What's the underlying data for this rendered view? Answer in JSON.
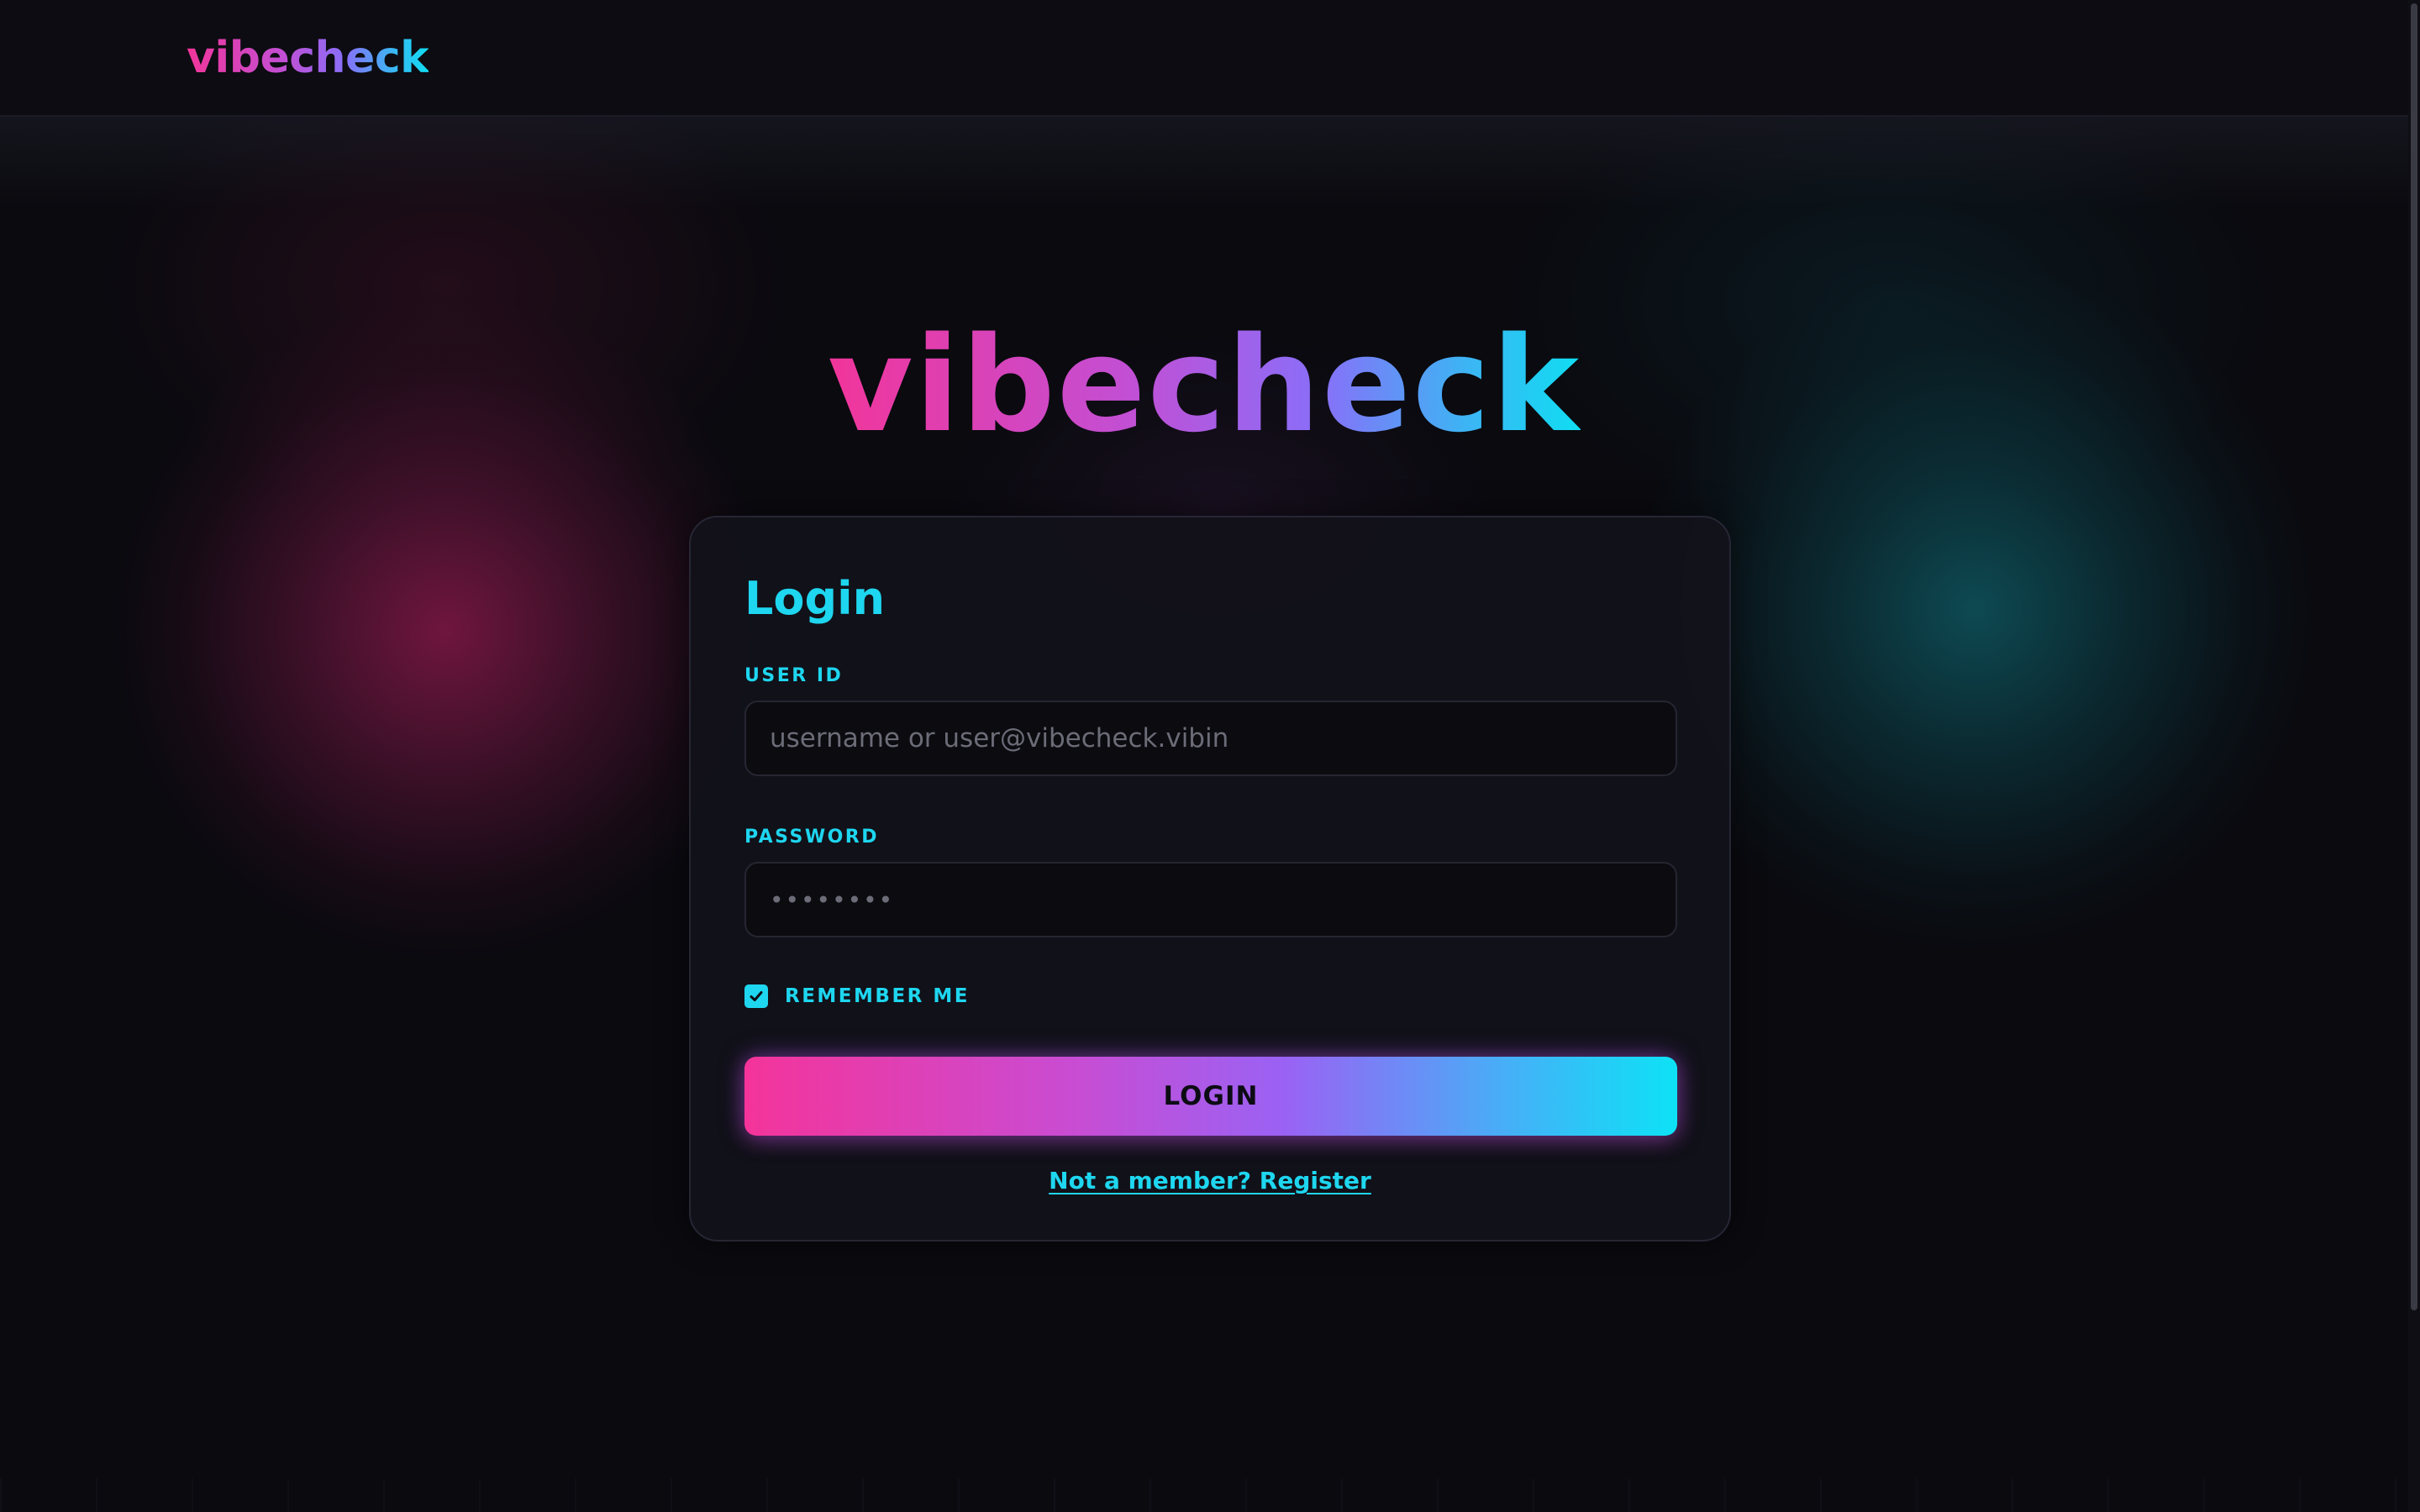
{
  "header": {
    "brand": "vibecheck"
  },
  "hero": {
    "title": "vibecheck"
  },
  "login_card": {
    "title": "Login",
    "user_id_label": "USER ID",
    "user_id_placeholder": "username or user@vibecheck.vibin",
    "user_id_value": "",
    "password_label": "PASSWORD",
    "password_placeholder": "••••••••",
    "password_value": "",
    "remember_me_label": "REMEMBER ME",
    "remember_me_checked": true,
    "login_button_label": "LOGIN",
    "register_link": "Not a member? Register"
  },
  "icons": {
    "remember_checkbox": "check-icon"
  },
  "colors": {
    "accent_cyan": "#1ed6ef",
    "accent_pink": "#f4349a",
    "accent_violet": "#9a62f4",
    "background": "#0a0a0f",
    "card_background": "#12121b"
  }
}
